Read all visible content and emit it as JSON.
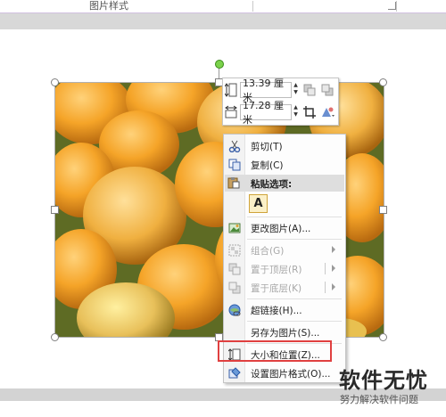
{
  "ribbon": {
    "group_label": "图片样式"
  },
  "mini_toolbar": {
    "height_value": "13.39 厘米",
    "width_value": "17.28 厘米"
  },
  "context_menu": {
    "items": [
      {
        "label": "剪切(T)",
        "icon": "scissors-icon",
        "enabled": true
      },
      {
        "label": "复制(C)",
        "icon": "copy-icon",
        "enabled": true
      },
      {
        "label": "粘贴选项:",
        "icon": "paste-icon",
        "enabled": true
      },
      {
        "label": "A",
        "icon": "paste-keep-text-icon",
        "enabled": true
      },
      {
        "label": "更改图片(A)...",
        "icon": "change-picture-icon",
        "enabled": true
      },
      {
        "label": "组合(G)",
        "icon": "group-icon",
        "enabled": false
      },
      {
        "label": "置于顶层(R)",
        "icon": "bring-to-front-icon",
        "enabled": false
      },
      {
        "label": "置于底层(K)",
        "icon": "send-to-back-icon",
        "enabled": false
      },
      {
        "label": "超链接(H)...",
        "icon": "hyperlink-icon",
        "enabled": true
      },
      {
        "label": "另存为图片(S)...",
        "icon": "save-as-picture-icon",
        "enabled": true
      },
      {
        "label": "大小和位置(Z)...",
        "icon": "size-position-icon",
        "enabled": true
      },
      {
        "label": "设置图片格式(O)...",
        "icon": "format-picture-icon",
        "enabled": true
      }
    ]
  },
  "watermark": {
    "title": "软件无忧",
    "subtitle": "努力解决软件问题"
  },
  "colors": {
    "highlight": "#e04040",
    "rotate_handle": "#7bd24b",
    "paste_accent": "#cfa43a"
  }
}
